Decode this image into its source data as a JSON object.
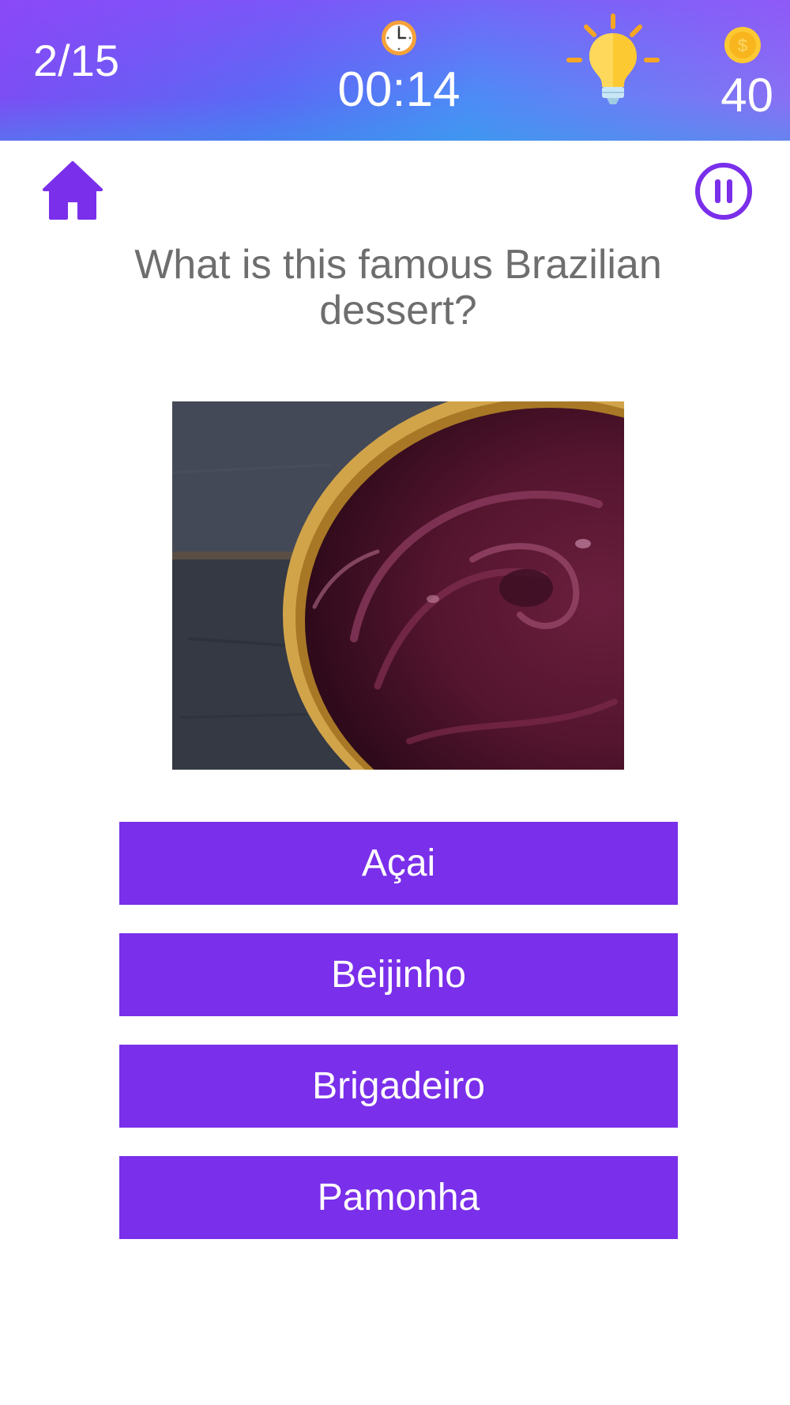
{
  "header": {
    "progress": "2/15",
    "timer": "00:14",
    "coins": "40",
    "icons": {
      "clock": "clock-icon",
      "hint": "lightbulb-icon",
      "coin": "coin-icon"
    }
  },
  "toolbar": {
    "icons": {
      "home": "home-icon",
      "pause": "pause-icon"
    }
  },
  "question": {
    "text": "What is this famous Brazilian dessert?"
  },
  "answers": [
    {
      "label": "Açai"
    },
    {
      "label": "Beijinho"
    },
    {
      "label": "Brigadeiro"
    },
    {
      "label": "Pamonha"
    }
  ],
  "colors": {
    "accent": "#7a2fea",
    "header_start": "#7d4cf4",
    "header_end": "#4c8cf6",
    "question_text": "#6e6e6e",
    "hint_bulb": "#fcc933",
    "coin": "#f8b51d"
  }
}
